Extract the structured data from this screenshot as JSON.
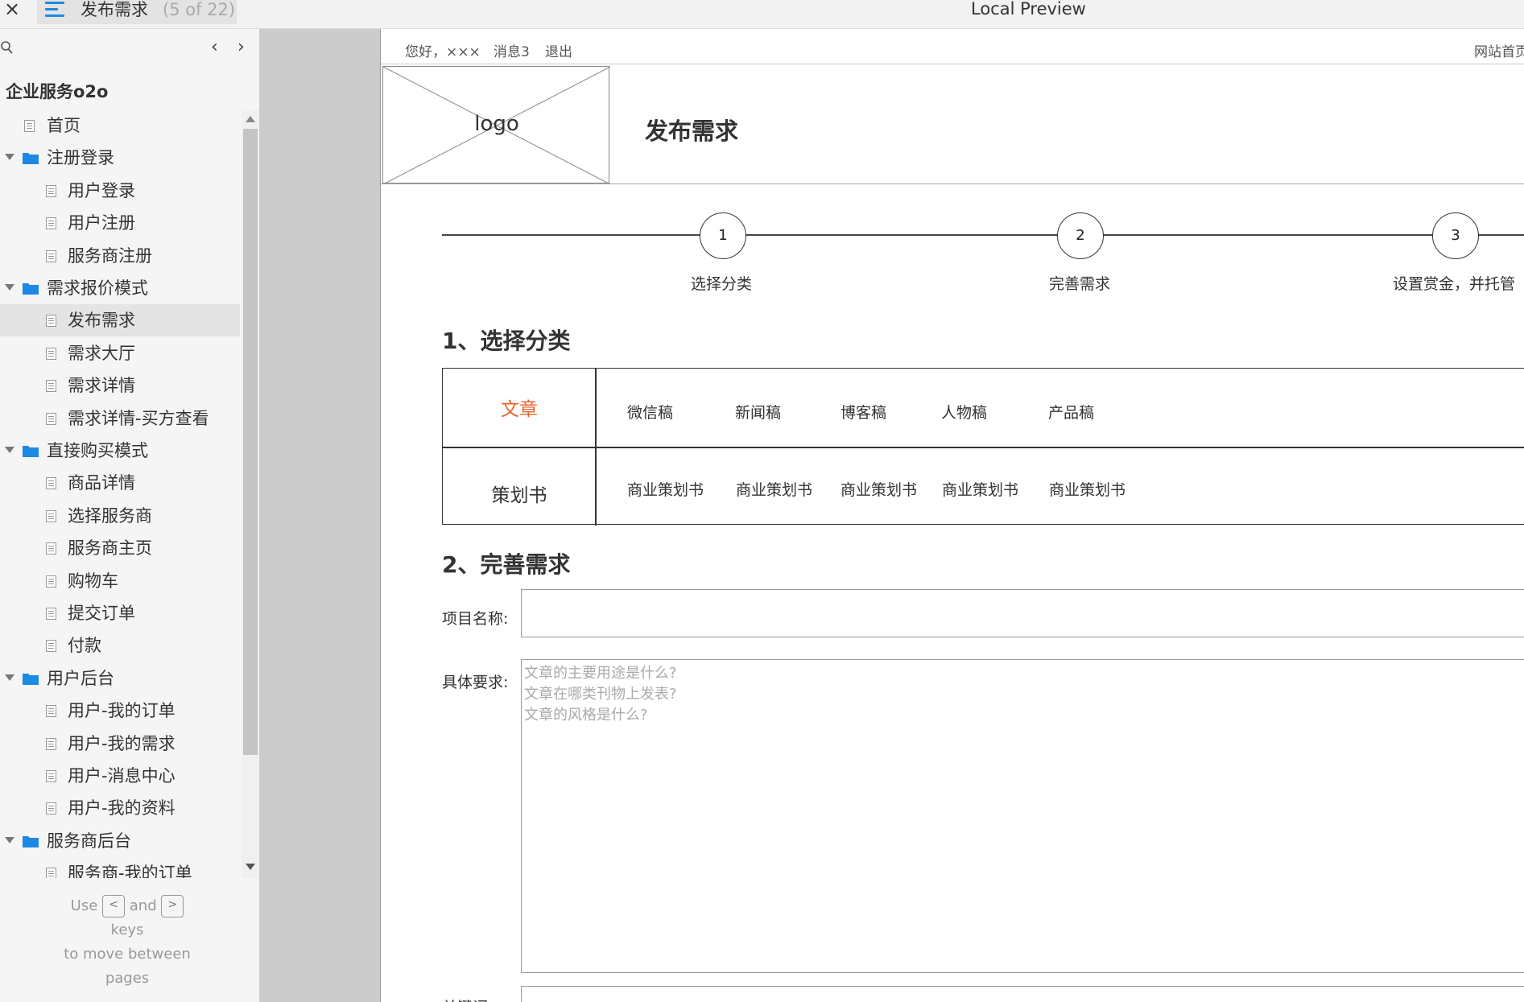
{
  "window": {
    "page_tab_title": "发布需求",
    "page_count": "(5 of 22)",
    "app_title": "Local Preview"
  },
  "sidebar": {
    "project_title": "企业服务o2o",
    "tree": [
      {
        "label": "首页",
        "type": "page"
      },
      {
        "label": "注册登录",
        "type": "folder"
      },
      {
        "label": "用户登录",
        "type": "page"
      },
      {
        "label": "用户注册",
        "type": "page"
      },
      {
        "label": "服务商注册",
        "type": "page"
      },
      {
        "label": "需求报价模式",
        "type": "folder"
      },
      {
        "label": "发布需求",
        "type": "page",
        "selected": true
      },
      {
        "label": "需求大厅",
        "type": "page"
      },
      {
        "label": "需求详情",
        "type": "page"
      },
      {
        "label": "需求详情-买方查看",
        "type": "page"
      },
      {
        "label": "直接购买模式",
        "type": "folder"
      },
      {
        "label": "商品详情",
        "type": "page"
      },
      {
        "label": "选择服务商",
        "type": "page"
      },
      {
        "label": "服务商主页",
        "type": "page"
      },
      {
        "label": "购物车",
        "type": "page"
      },
      {
        "label": "提交订单",
        "type": "page"
      },
      {
        "label": "付款",
        "type": "page"
      },
      {
        "label": "用户后台",
        "type": "folder"
      },
      {
        "label": "用户-我的订单",
        "type": "page"
      },
      {
        "label": "用户-我的需求",
        "type": "page"
      },
      {
        "label": "用户-消息中心",
        "type": "page"
      },
      {
        "label": "用户-我的资料",
        "type": "page"
      },
      {
        "label": "服务商后台",
        "type": "folder"
      },
      {
        "label": "服务商-我的订单",
        "type": "page"
      }
    ],
    "help": {
      "use": "Use",
      "and": "and",
      "keys": "keys",
      "to_move": "to move between",
      "pages": "pages",
      "prev_key": "<",
      "next_key": ">"
    }
  },
  "canvas": {
    "util": {
      "greeting": "您好，×××",
      "messages": "消息3",
      "logout": "退出",
      "home": "网站首页"
    },
    "logo_text": "logo",
    "heading": "发布需求",
    "steps": [
      {
        "num": "1",
        "label": "选择分类"
      },
      {
        "num": "2",
        "label": "完善需求"
      },
      {
        "num": "3",
        "label": "设置赏金，并托管"
      }
    ],
    "section1_title": "1、选择分类",
    "categories": [
      {
        "name": "文章",
        "items": [
          "微信稿",
          "新闻稿",
          "博客稿",
          "人物稿",
          "产品稿"
        ]
      },
      {
        "name": "策划书",
        "items": [
          "商业策划书",
          "商业策划书",
          "商业策划书",
          "商业策划书",
          "商业策划书"
        ]
      }
    ],
    "section2_title": "2、完善需求",
    "form": {
      "project_label": "项目名称:",
      "project_value": "",
      "requirements_label": "具体要求:",
      "requirements_placeholder": "文章的主要用途是什么?\n文章在哪类刊物上发表?\n文章的风格是什么?",
      "keywords_label": "关键词:"
    }
  },
  "colors": {
    "accent_blue": "#1e88e5",
    "active_category": "#e8622d",
    "gutter": "#cbcbcb"
  }
}
